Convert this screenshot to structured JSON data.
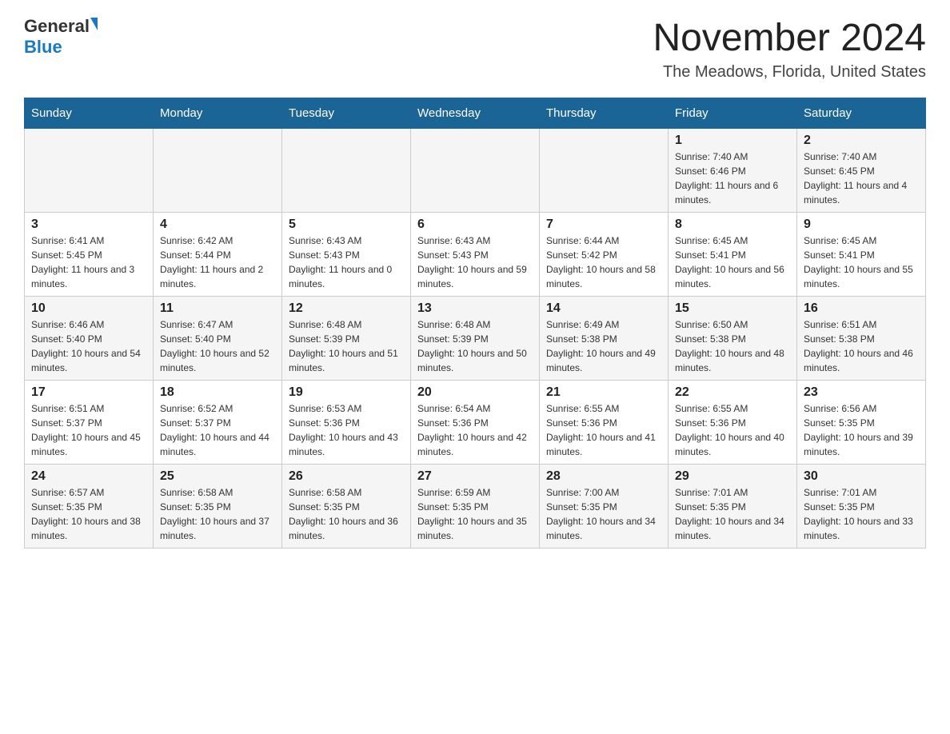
{
  "header": {
    "title": "November 2024",
    "subtitle": "The Meadows, Florida, United States",
    "logo": {
      "general": "General",
      "blue": "Blue"
    }
  },
  "days_of_week": [
    "Sunday",
    "Monday",
    "Tuesday",
    "Wednesday",
    "Thursday",
    "Friday",
    "Saturday"
  ],
  "weeks": [
    [
      {
        "day": "",
        "info": ""
      },
      {
        "day": "",
        "info": ""
      },
      {
        "day": "",
        "info": ""
      },
      {
        "day": "",
        "info": ""
      },
      {
        "day": "",
        "info": ""
      },
      {
        "day": "1",
        "info": "Sunrise: 7:40 AM\nSunset: 6:46 PM\nDaylight: 11 hours and 6 minutes."
      },
      {
        "day": "2",
        "info": "Sunrise: 7:40 AM\nSunset: 6:45 PM\nDaylight: 11 hours and 4 minutes."
      }
    ],
    [
      {
        "day": "3",
        "info": "Sunrise: 6:41 AM\nSunset: 5:45 PM\nDaylight: 11 hours and 3 minutes."
      },
      {
        "day": "4",
        "info": "Sunrise: 6:42 AM\nSunset: 5:44 PM\nDaylight: 11 hours and 2 minutes."
      },
      {
        "day": "5",
        "info": "Sunrise: 6:43 AM\nSunset: 5:43 PM\nDaylight: 11 hours and 0 minutes."
      },
      {
        "day": "6",
        "info": "Sunrise: 6:43 AM\nSunset: 5:43 PM\nDaylight: 10 hours and 59 minutes."
      },
      {
        "day": "7",
        "info": "Sunrise: 6:44 AM\nSunset: 5:42 PM\nDaylight: 10 hours and 58 minutes."
      },
      {
        "day": "8",
        "info": "Sunrise: 6:45 AM\nSunset: 5:41 PM\nDaylight: 10 hours and 56 minutes."
      },
      {
        "day": "9",
        "info": "Sunrise: 6:45 AM\nSunset: 5:41 PM\nDaylight: 10 hours and 55 minutes."
      }
    ],
    [
      {
        "day": "10",
        "info": "Sunrise: 6:46 AM\nSunset: 5:40 PM\nDaylight: 10 hours and 54 minutes."
      },
      {
        "day": "11",
        "info": "Sunrise: 6:47 AM\nSunset: 5:40 PM\nDaylight: 10 hours and 52 minutes."
      },
      {
        "day": "12",
        "info": "Sunrise: 6:48 AM\nSunset: 5:39 PM\nDaylight: 10 hours and 51 minutes."
      },
      {
        "day": "13",
        "info": "Sunrise: 6:48 AM\nSunset: 5:39 PM\nDaylight: 10 hours and 50 minutes."
      },
      {
        "day": "14",
        "info": "Sunrise: 6:49 AM\nSunset: 5:38 PM\nDaylight: 10 hours and 49 minutes."
      },
      {
        "day": "15",
        "info": "Sunrise: 6:50 AM\nSunset: 5:38 PM\nDaylight: 10 hours and 48 minutes."
      },
      {
        "day": "16",
        "info": "Sunrise: 6:51 AM\nSunset: 5:38 PM\nDaylight: 10 hours and 46 minutes."
      }
    ],
    [
      {
        "day": "17",
        "info": "Sunrise: 6:51 AM\nSunset: 5:37 PM\nDaylight: 10 hours and 45 minutes."
      },
      {
        "day": "18",
        "info": "Sunrise: 6:52 AM\nSunset: 5:37 PM\nDaylight: 10 hours and 44 minutes."
      },
      {
        "day": "19",
        "info": "Sunrise: 6:53 AM\nSunset: 5:36 PM\nDaylight: 10 hours and 43 minutes."
      },
      {
        "day": "20",
        "info": "Sunrise: 6:54 AM\nSunset: 5:36 PM\nDaylight: 10 hours and 42 minutes."
      },
      {
        "day": "21",
        "info": "Sunrise: 6:55 AM\nSunset: 5:36 PM\nDaylight: 10 hours and 41 minutes."
      },
      {
        "day": "22",
        "info": "Sunrise: 6:55 AM\nSunset: 5:36 PM\nDaylight: 10 hours and 40 minutes."
      },
      {
        "day": "23",
        "info": "Sunrise: 6:56 AM\nSunset: 5:35 PM\nDaylight: 10 hours and 39 minutes."
      }
    ],
    [
      {
        "day": "24",
        "info": "Sunrise: 6:57 AM\nSunset: 5:35 PM\nDaylight: 10 hours and 38 minutes."
      },
      {
        "day": "25",
        "info": "Sunrise: 6:58 AM\nSunset: 5:35 PM\nDaylight: 10 hours and 37 minutes."
      },
      {
        "day": "26",
        "info": "Sunrise: 6:58 AM\nSunset: 5:35 PM\nDaylight: 10 hours and 36 minutes."
      },
      {
        "day": "27",
        "info": "Sunrise: 6:59 AM\nSunset: 5:35 PM\nDaylight: 10 hours and 35 minutes."
      },
      {
        "day": "28",
        "info": "Sunrise: 7:00 AM\nSunset: 5:35 PM\nDaylight: 10 hours and 34 minutes."
      },
      {
        "day": "29",
        "info": "Sunrise: 7:01 AM\nSunset: 5:35 PM\nDaylight: 10 hours and 34 minutes."
      },
      {
        "day": "30",
        "info": "Sunrise: 7:01 AM\nSunset: 5:35 PM\nDaylight: 10 hours and 33 minutes."
      }
    ]
  ]
}
